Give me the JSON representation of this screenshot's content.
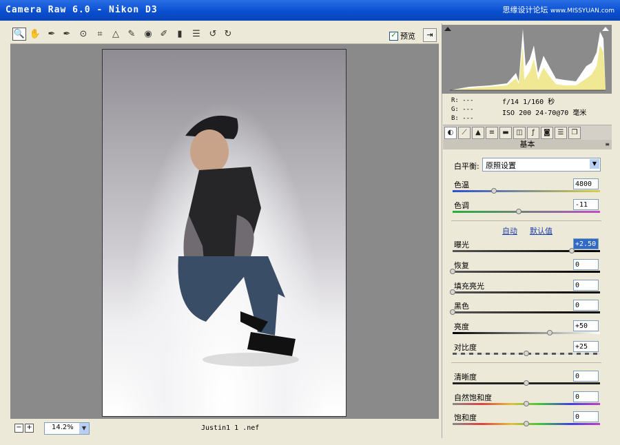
{
  "window": {
    "title": "Camera Raw 6.0 -  Nikon D3",
    "watermark_cn": "思缘设计论坛",
    "watermark_url": "www.MISSYUAN.com"
  },
  "toolbar": {
    "tools": [
      "zoom-tool",
      "hand-tool",
      "white-balance-tool",
      "color-sampler-tool",
      "targeted-adjustment-tool",
      "crop-tool",
      "straighten-tool",
      "spot-removal-tool",
      "red-eye-tool",
      "adjustment-brush-tool",
      "graduated-filter-tool",
      "preferences",
      "rotate-ccw",
      "rotate-cw"
    ],
    "preview_label": "预览",
    "preview_checked": true
  },
  "status": {
    "zoom": "14.2%",
    "filename": "Justin1 1 .nef",
    "zoom_out": "−",
    "zoom_in": "+"
  },
  "info": {
    "r": "R:  ---",
    "g": "G:  ---",
    "b": "B:  ---",
    "exif_line1": "f/14   1/160 秒",
    "exif_line2": "ISO 200   24-70@70 毫米"
  },
  "panel": {
    "section_title": "基本",
    "wb_label": "白平衡:",
    "wb_value": "原照设置",
    "auto_link": "自动",
    "default_link": "默认值",
    "sliders": [
      {
        "label": "色温",
        "value": "4800",
        "pos": 0.28
      },
      {
        "label": "色调",
        "value": "-11",
        "pos": 0.45
      },
      {
        "label": "曝光",
        "value": "+2.50",
        "pos": 0.81
      },
      {
        "label": "恢复",
        "value": "0",
        "pos": 0.0
      },
      {
        "label": "填充亮光",
        "value": "0",
        "pos": 0.0
      },
      {
        "label": "黑色",
        "value": "0",
        "pos": 0.0
      },
      {
        "label": "亮度",
        "value": "+50",
        "pos": 0.66
      },
      {
        "label": "对比度",
        "value": "+25",
        "pos": 0.5
      },
      {
        "label": "清晰度",
        "value": "0",
        "pos": 0.5
      },
      {
        "label": "自然饱和度",
        "value": "0",
        "pos": 0.5
      },
      {
        "label": "饱和度",
        "value": "0",
        "pos": 0.5
      }
    ]
  },
  "colors": {
    "titlebar": "#0a4fd0",
    "panel_bg": "#ece9d8",
    "canvas_bg": "#8a8a8a"
  }
}
